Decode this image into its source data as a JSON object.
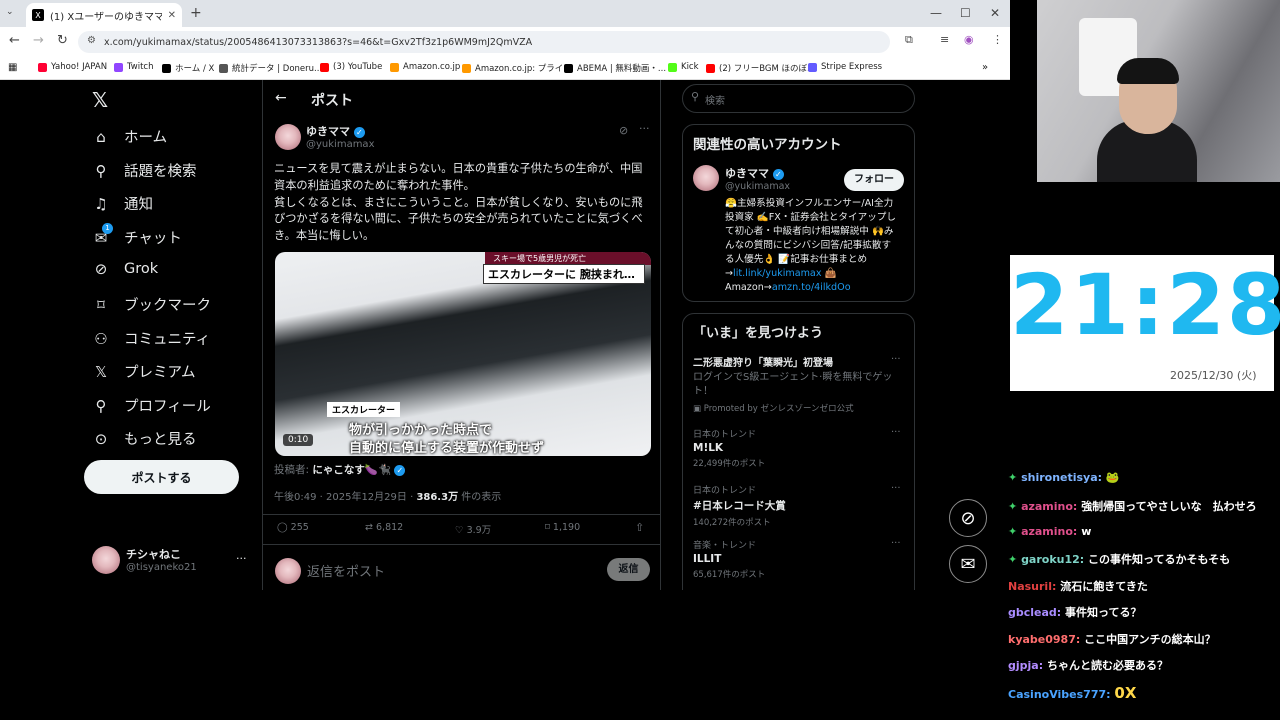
{
  "browser": {
    "tab_title": "(1) Xユーザーのゆきママさん:「ニュー...",
    "new_tab": "+",
    "url": "x.com/yukimamax/status/2005486413073313863?s=46&t=Gxv2Tf3z1p6WM9mJ2QmVZA",
    "bookmarks": [
      "Yahoo! JAPAN",
      "Twitch",
      "ホーム / X",
      "統計データ | Doneru...",
      "(3) YouTube",
      "Amazon.co.jp",
      "Amazon.co.jp: プライ...",
      "ABEMA | 無料動画・...",
      "Kick",
      "(2) フリーBGM ほのぼ...",
      "Stripe Express"
    ]
  },
  "sidebar": {
    "items": [
      "ホーム",
      "話題を検索",
      "通知",
      "チャット",
      "Grok",
      "ブックマーク",
      "コミュニティ",
      "プレミアム",
      "プロフィール",
      "もっと見る"
    ],
    "post_button": "ポストする",
    "account_name": "チシャねこ",
    "account_handle": "@tisyaneko21",
    "chat_badge": "1"
  },
  "header": {
    "title": "ポスト"
  },
  "post": {
    "author": "ゆきママ",
    "handle": "@yukimamax",
    "text_1": "ニュースを見て震えが止まらない。日本の貴重な子供たちの生命が、中国資本の利益追求のために奪われた事件。",
    "text_2": "貧しくなるとは、まさにこういうこと。日本が貧しくなり、安いものに飛びつかざるを得ない間に、子供たちの安全が売られていたことに気づくべき。本当に悔しい。",
    "video_tag": "スキー場で5歳男児が死亡",
    "video_headline": "エスカレーターに 腕挟まれ…",
    "video_label": "エスカレーター",
    "video_caption_1": "物が引っかかった時点で",
    "video_caption_2": "自動的に停止する装置が作動せず",
    "video_time": "0:10",
    "poster_label": "投稿者:",
    "poster_name": "にゃこなす🍆🐈‍⬛",
    "meta_time": "午後0:49 · 2025年12月29日 · ",
    "meta_views": "386.3万",
    "meta_views_suffix": " 件の表示",
    "replies": "255",
    "reposts": "6,812",
    "likes": "3.9万",
    "bookmarks": "1,190",
    "reply_placeholder": "返信をポスト",
    "reply_button": "返信"
  },
  "right": {
    "search_placeholder": "検索",
    "related_title": "関連性の高いアカウント",
    "acc_name": "ゆきママ",
    "acc_handle": "@yukimamax",
    "follow_label": "フォロー",
    "bio_1": "😤主婦系投資インフルエンサー/AI全力",
    "bio_2": "投資家 ✍️FX・証券会社とタイアップし",
    "bio_3": "て初心者・中級者向け相場解説中 🙌み",
    "bio_4": "んなの質問にビシバシ回答/記事拡散す",
    "bio_5": "る人優先👌 📝記事お仕事まとめ",
    "bio_link1": "lit.link/yukimamax",
    "bio_link2": "amzn.to/4ilkdOo",
    "bio_amazon": "Amazon→",
    "trends_title": "「いま」を見つけよう",
    "trends": [
      {
        "category": "",
        "name": "二形悪虚狩り「葉瞬光」初登場",
        "sub": "ログインでS級エージェント·瞬を無料でゲット！",
        "count": "Promoted by ゼンレスゾーンゼロ公式"
      },
      {
        "category": "日本のトレンド",
        "name": "M!LK",
        "sub": "",
        "count": "22,499件のポスト"
      },
      {
        "category": "日本のトレンド",
        "name": "#日本レコード大賞",
        "sub": "",
        "count": "140,272件のポスト"
      },
      {
        "category": "音楽・トレンド",
        "name": "ILLIT",
        "sub": "",
        "count": "65,617件のポスト"
      }
    ]
  },
  "clock": {
    "time": "21:28",
    "date": "2025/12/30 (火)"
  },
  "chat": [
    {
      "user": "shironetisya:",
      "text": "🐸",
      "color": "#7fb4ff"
    },
    {
      "user": "azamino:",
      "text": "強制帰国ってやさしいな　払わせろ",
      "color": "#e0508c"
    },
    {
      "user": "azamino:",
      "text": "w",
      "color": "#e0508c"
    },
    {
      "user": "garoku12:",
      "text": "この事件知ってるかそもそも",
      "color": "#7fd4c8"
    },
    {
      "user": "Nasuril:",
      "text": "流石に飽きてきた",
      "color": "#e04040"
    },
    {
      "user": "gbclead:",
      "text": "事件知ってる？",
      "color": "#a98cff"
    },
    {
      "user": "kyabe0987:",
      "text": "ここ中国アンチの総本山？",
      "color": "#ff6e6e"
    },
    {
      "user": "gjpja:",
      "text": "ちゃんと読む必要ある？",
      "color": "#b38cff"
    },
    {
      "user": "CasinoVibes777:",
      "text": "0X",
      "color": "#4aa3ff"
    }
  ],
  "colors": {
    "accent": "#1d9bf0",
    "clock_text": "#1fb8f0"
  }
}
